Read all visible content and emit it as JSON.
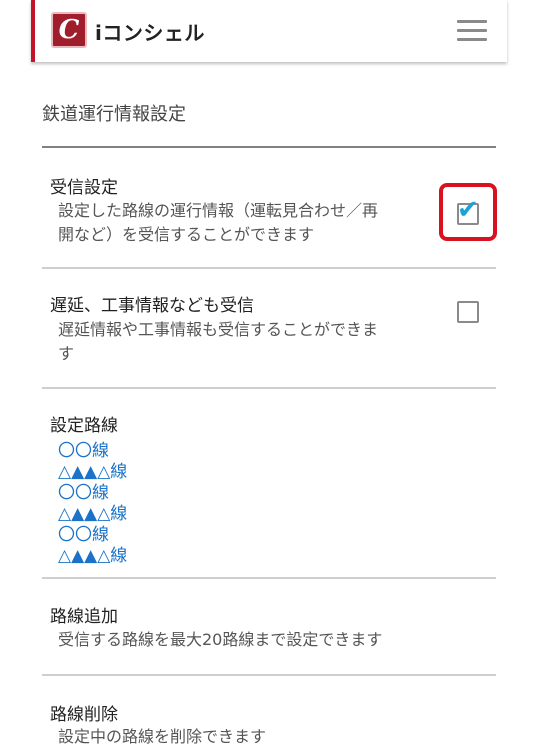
{
  "header": {
    "logo_letter": "C",
    "app_title": "iコンシェル",
    "menu_icon": "hamburger-menu-icon"
  },
  "page": {
    "title": "鉄道運行情報設定"
  },
  "settings": {
    "receive": {
      "title": "受信設定",
      "desc_line1": "設定した路線の運行情報（運転見合わせ／再",
      "desc_line2": "開など）を受信することができます",
      "checked": true
    },
    "delay": {
      "title": "遅延、工事情報なども受信",
      "desc_line1": "遅延情報や工事情報も受信することができま",
      "desc_line2": "す",
      "checked": false
    }
  },
  "routes": {
    "title": "設定路線",
    "items": [
      "〇〇線",
      "△▲▲△線",
      "〇〇線",
      "△▲▲△線",
      "〇〇線",
      "△▲▲△線"
    ]
  },
  "add_route": {
    "title": "路線追加",
    "desc": "受信する路線を最大20路線まで設定できます"
  },
  "delete_route": {
    "title": "路線削除",
    "desc": "設定中の路線を削除できます"
  },
  "colors": {
    "brand": "#a01d2b",
    "accent_bar": "#c4142a",
    "link": "#1a73c9",
    "check": "#1aa3d6",
    "highlight": "#d8121e"
  }
}
